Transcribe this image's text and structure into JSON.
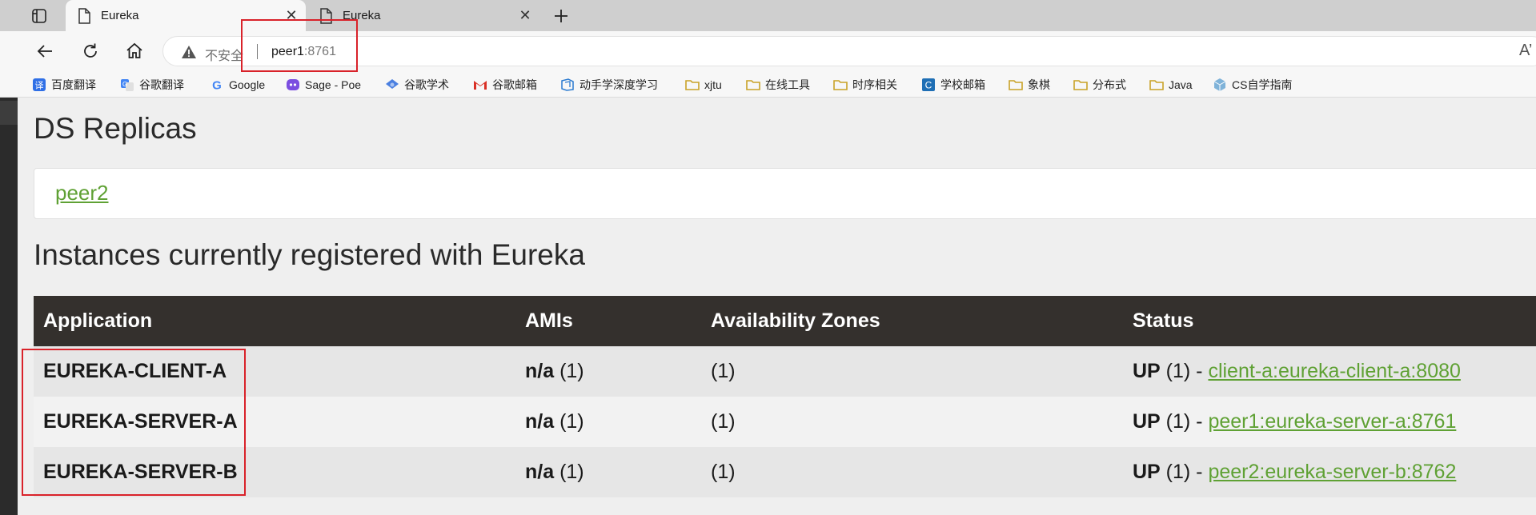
{
  "browser": {
    "tabs": [
      {
        "title": "Eureka",
        "active": true
      },
      {
        "title": "Eureka",
        "active": false
      }
    ],
    "close_glyph": "✕",
    "address_bar": {
      "security_label": "不安全",
      "url_host": "peer1",
      "url_port": ":8761"
    },
    "read_aloud_glyph": "A’",
    "bookmarks": [
      {
        "label": "百度翻译",
        "icon": "baidu-translate-icon"
      },
      {
        "label": "谷歌翻译",
        "icon": "google-translate-icon"
      },
      {
        "label": "Google",
        "icon": "google-icon"
      },
      {
        "label": "Sage - Poe",
        "icon": "poe-icon"
      },
      {
        "label": "谷歌学术",
        "icon": "scholar-icon"
      },
      {
        "label": "谷歌邮箱",
        "icon": "gmail-icon"
      },
      {
        "label": "动手学深度学习",
        "icon": "d2l-icon"
      },
      {
        "label": "xjtu",
        "icon": "folder-icon"
      },
      {
        "label": "在线工具",
        "icon": "folder-icon"
      },
      {
        "label": "时序相关",
        "icon": "folder-icon"
      },
      {
        "label": "学校邮箱",
        "icon": "school-mail-icon"
      },
      {
        "label": "象棋",
        "icon": "folder-icon"
      },
      {
        "label": "分布式",
        "icon": "folder-icon"
      },
      {
        "label": "Java",
        "icon": "folder-icon"
      },
      {
        "label": "CS自学指南",
        "icon": "cube-icon"
      }
    ]
  },
  "page": {
    "replicas_heading": "DS Replicas",
    "replica_link": "peer2",
    "instances_heading": "Instances currently registered with Eureka",
    "table": {
      "headers": [
        "Application",
        "AMIs",
        "Availability Zones",
        "Status"
      ],
      "rows": [
        {
          "application": "EUREKA-CLIENT-A",
          "ami_value": "n/a",
          "ami_count": " (1)",
          "zones": "(1)",
          "status_prefix": "UP",
          "status_count": " (1) - ",
          "instance_link": "client-a:eureka-client-a:8080"
        },
        {
          "application": "EUREKA-SERVER-A",
          "ami_value": "n/a",
          "ami_count": " (1)",
          "zones": "(1)",
          "status_prefix": "UP",
          "status_count": " (1) - ",
          "instance_link": "peer1:eureka-server-a:8761"
        },
        {
          "application": "EUREKA-SERVER-B",
          "ami_value": "n/a",
          "ami_count": " (1)",
          "zones": "(1)",
          "status_prefix": "UP",
          "status_count": " (1) - ",
          "instance_link": "peer2:eureka-server-b:8762"
        }
      ]
    }
  },
  "colors": {
    "link_green": "#5fa134",
    "table_header_bg": "#34302d",
    "annotation_red": "#d9222a"
  }
}
